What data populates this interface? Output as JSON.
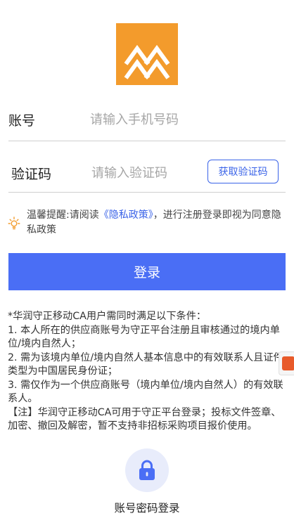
{
  "account": {
    "label": "账号",
    "placeholder": "请输入手机号码"
  },
  "code": {
    "label": "验证码",
    "placeholder": "请输入验证码",
    "button": "获取验证码"
  },
  "tip": {
    "prefix": "温馨提醒:请阅读",
    "link": "《隐私政策》",
    "suffix": "，进行注册登录即视为同意隐私政策"
  },
  "login": {
    "button": "登录"
  },
  "notes": [
    "*华润守正移动CA用户需同时满足以下条件：",
    "1. 本人所在的供应商账号为守正平台注册且审核通过的境内单位/境内自然人；",
    "2. 需为该境内单位/境内自然人基本信息中的有效联系人且证件类型为中国居民身份证；",
    "3. 需仅作为一个供应商账号（境内单位/境内自然人）的有效联系人。",
    "【注】华润守正移动CA可用于守正平台登录；投标文件签章、加密、撤回及解密，暂不支持非招标采购项目报价使用。"
  ],
  "password_login": {
    "label": "账号密码登录"
  },
  "icons": {
    "logo": "logo-icon",
    "tip": "lightbulb-icon",
    "lock": "lock-icon"
  },
  "colors": {
    "accent": "#4a6ef5",
    "link": "#3a63e8",
    "logo": "#F39B2C"
  }
}
